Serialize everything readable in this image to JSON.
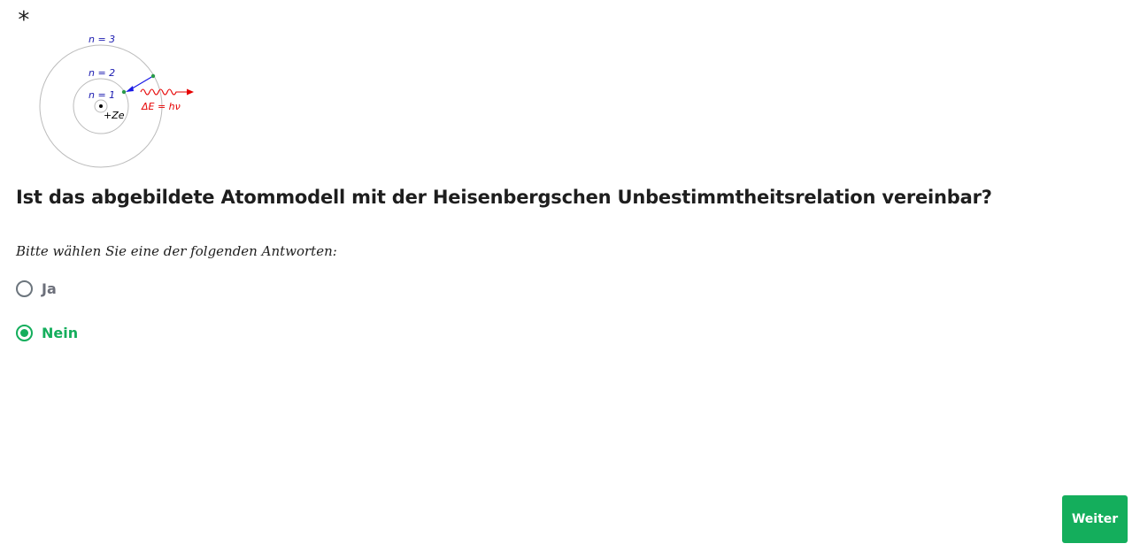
{
  "question": {
    "required_mark": "*",
    "text": "Ist das abgebildete Atommodell mit der Heisenbergschen Unbestimmtheitsrelation vereinbar?",
    "instruction": "Bitte wählen Sie eine der folgenden Antworten:"
  },
  "figure": {
    "orbit_labels": [
      "n = 3",
      "n = 2",
      "n = 1"
    ],
    "nucleus_label": "+Ze",
    "photon_label": "ΔE = hν",
    "colors": {
      "orbit": "#bbbbbb",
      "labels": "#1a1ab0",
      "arrow": "#1a1ae6",
      "photon": "#e60000",
      "electron": "#2a9a4a"
    }
  },
  "answers": [
    {
      "label": "Ja",
      "selected": false
    },
    {
      "label": "Nein",
      "selected": true
    }
  ],
  "navigation": {
    "next_label": "Weiter"
  },
  "colors": {
    "accent": "#14ae5c",
    "unselected": "#6c6f7a"
  }
}
